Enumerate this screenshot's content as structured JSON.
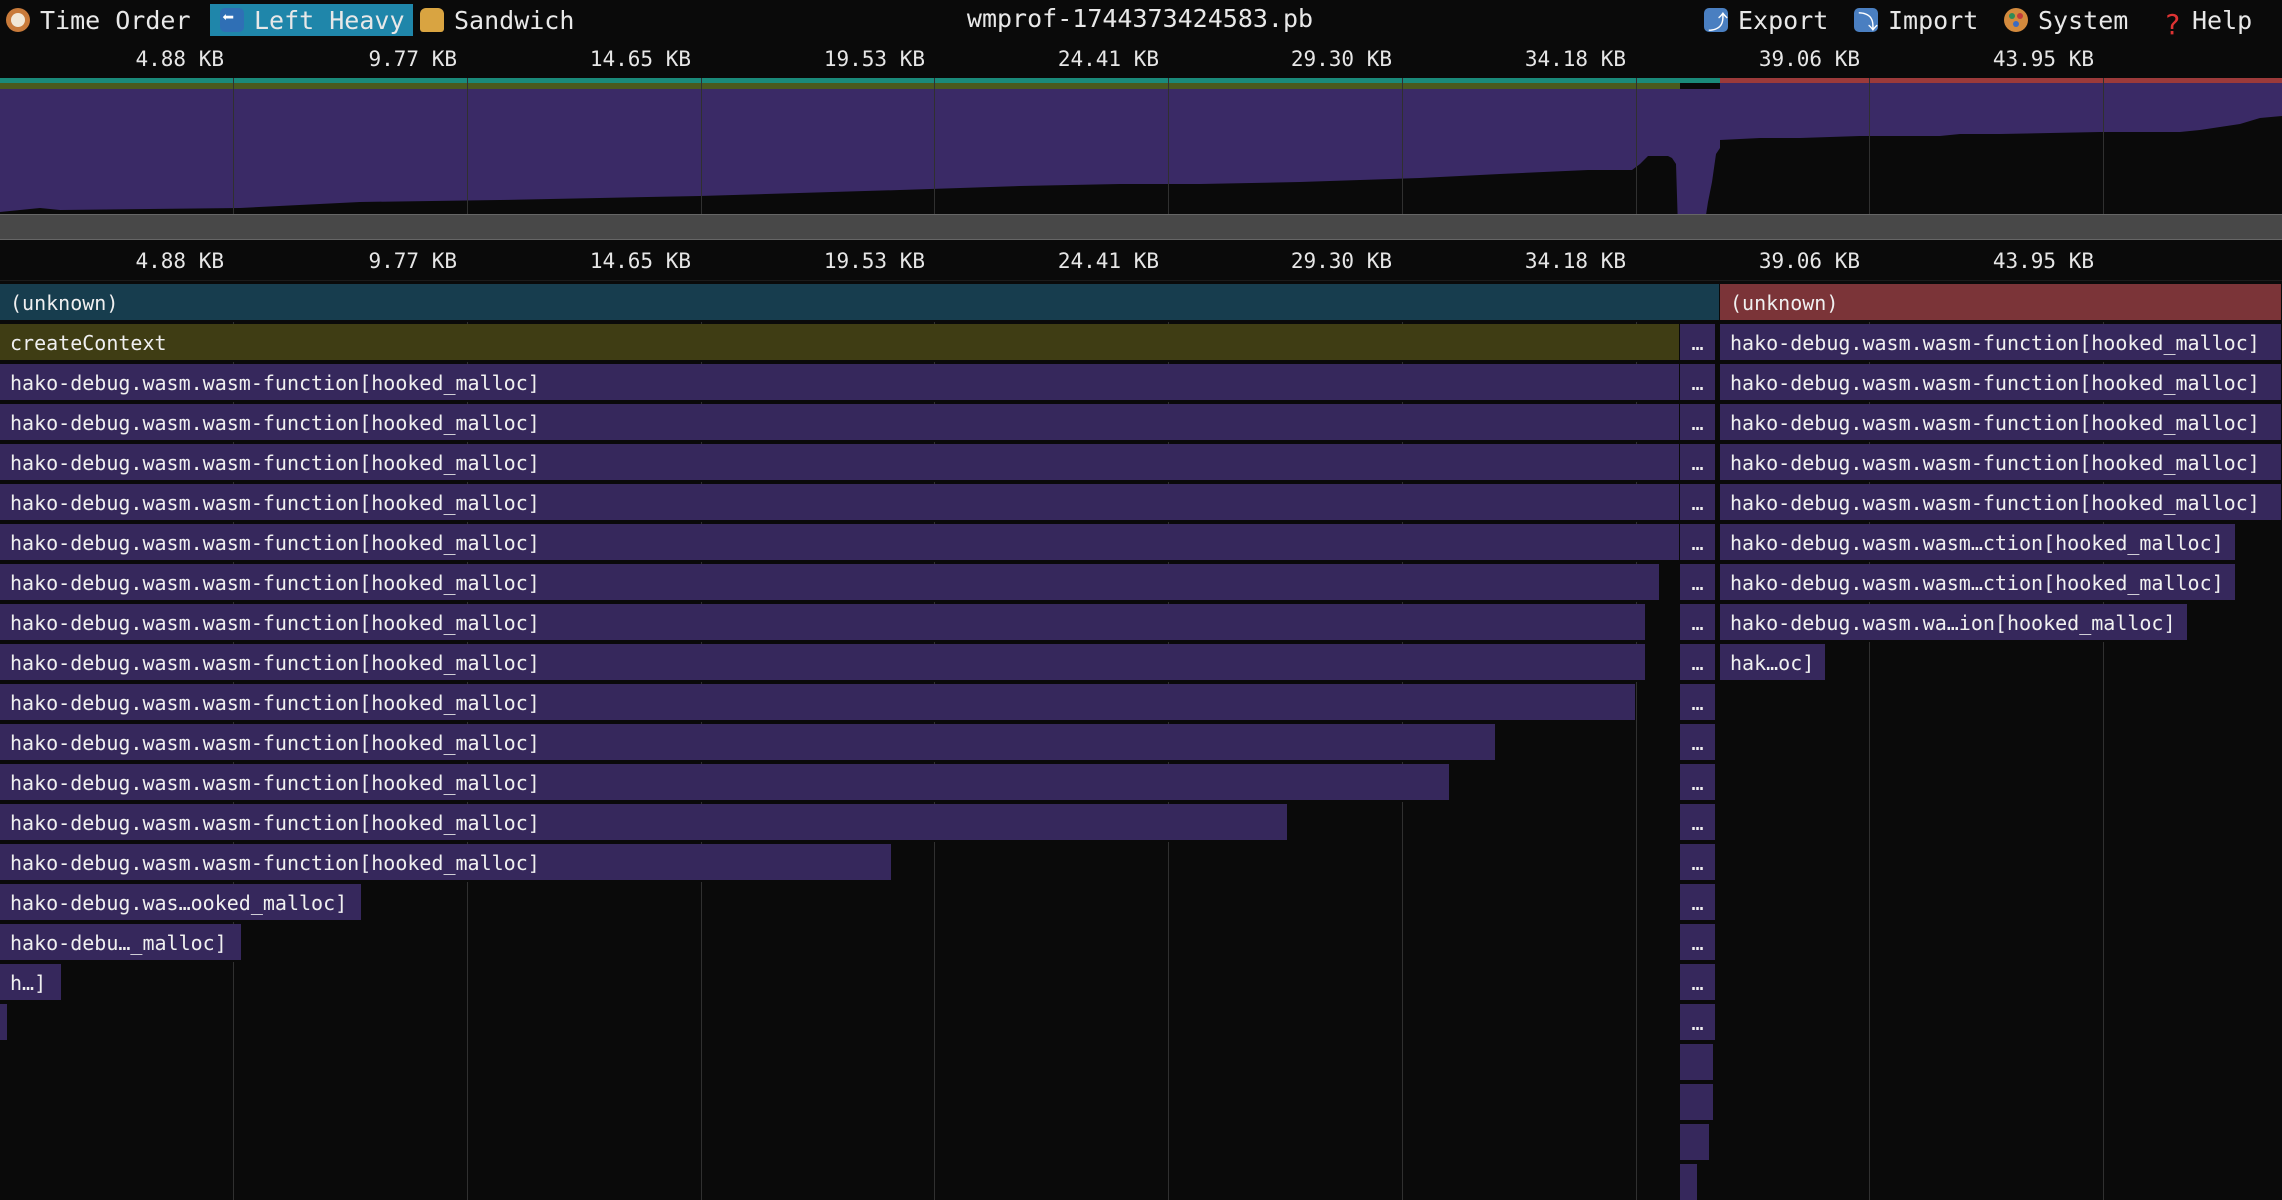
{
  "toolbar": {
    "time_order": "Time Order",
    "left_heavy": "Left Heavy",
    "sandwich": "Sandwich",
    "title": "wmprof-1744373424583.pb",
    "export": "Export",
    "import": "Import",
    "system": "System",
    "help": "Help"
  },
  "axis": {
    "ticks": [
      "4.88 KB",
      "9.77 KB",
      "14.65 KB",
      "19.53 KB",
      "24.41 KB",
      "29.30 KB",
      "34.18 KB",
      "39.06 KB",
      "43.95 KB"
    ]
  },
  "colors": {
    "unknown_left": "#173d4e",
    "unknown_right": "#7b3438",
    "create_context": "#3f3d14",
    "malloc": "#36285c",
    "active_tab": "#1f86aa"
  },
  "flame": {
    "unknown": "(unknown)",
    "create_context": "createContext",
    "malloc_full": "hako-debug.wasm.wasm-function[hooked_malloc]",
    "malloc_ellipsis": "…",
    "left_short_1": "hako-debug.was…ooked_malloc]",
    "left_short_2": "hako-debu…_malloc]",
    "left_short_3": "h…]",
    "right_short_1": "hako-debug.wasm.wasm…ction[hooked_malloc]",
    "right_short_2": "hako-debug.wasm.wa…ion[hooked_malloc]",
    "right_short_3": "hak…oc]"
  }
}
